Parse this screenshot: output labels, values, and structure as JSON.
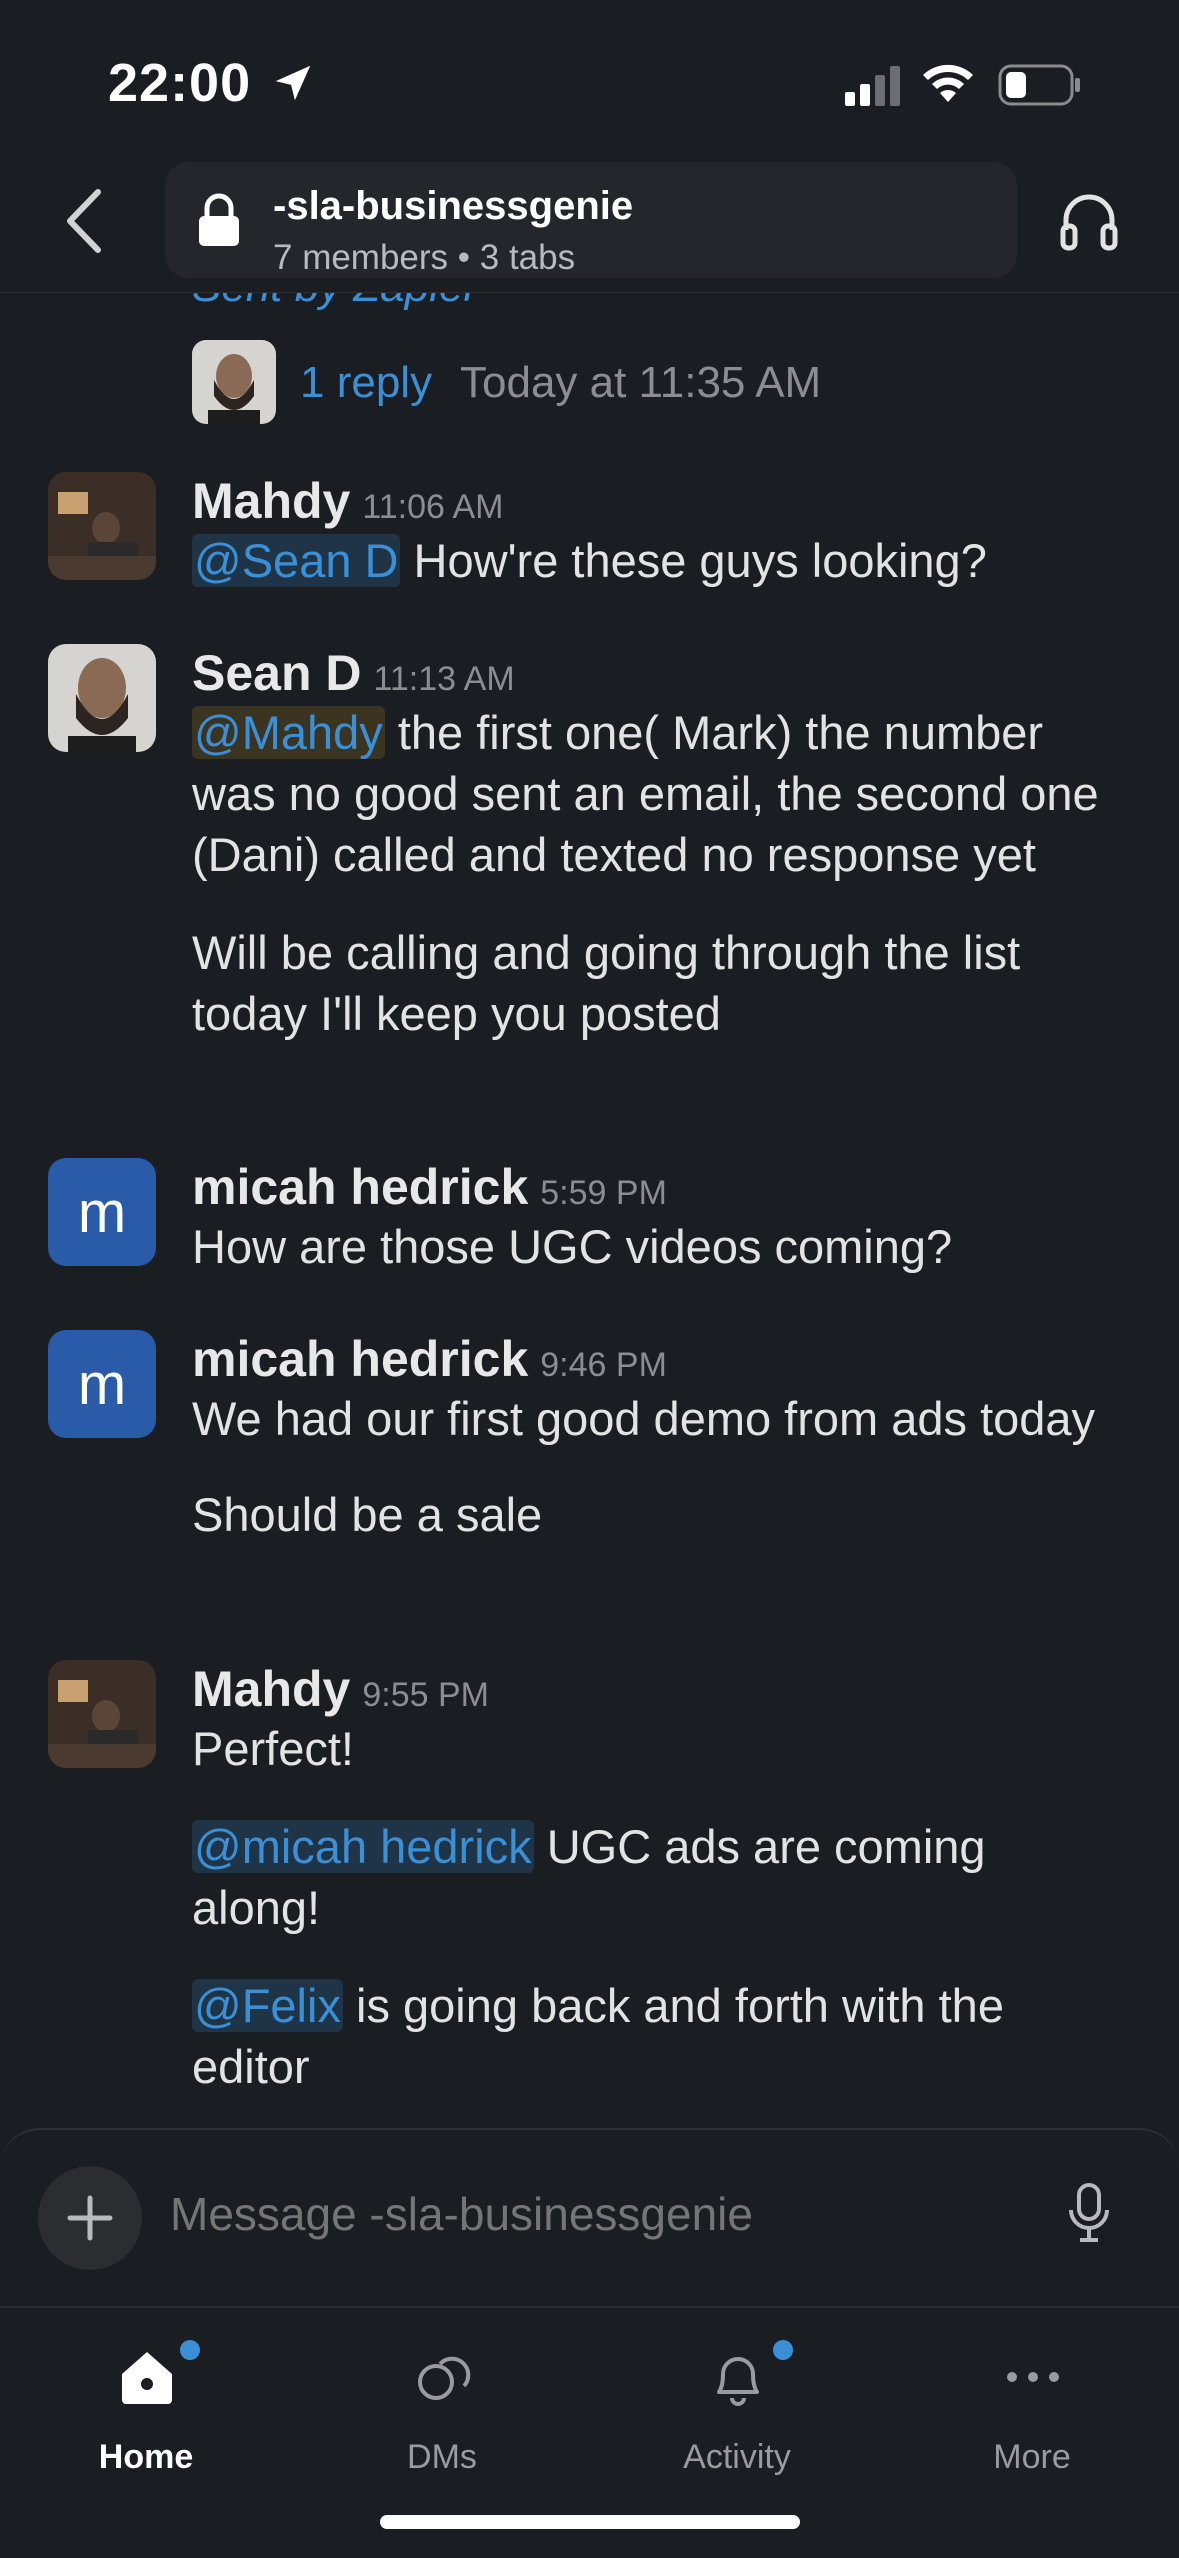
{
  "status_bar": {
    "time": "22:00"
  },
  "header": {
    "channel_name": "-sla-businessgenie",
    "channel_meta": "7 members • 3 tabs"
  },
  "thread": {
    "cutoff_text": "Sent by Zapier",
    "reply_count": "1 reply",
    "reply_time": "Today at 11:35 AM"
  },
  "messages": [
    {
      "name": "Mahdy",
      "time": "11:06 AM",
      "mention": "@Sean D",
      "text": " How're these guys looking?"
    },
    {
      "name": "Sean D",
      "time": "11:13 AM",
      "mention": "@Mahdy",
      "text": " the first one( Mark) the number was no good sent an email, the second one (Dani) called and texted no response yet",
      "text2": "Will be calling and going through the list today I'll keep you posted"
    },
    {
      "name": "micah hedrick",
      "time": "5:59 PM",
      "avatar_letter": "m",
      "text": "How are those UGC videos coming?"
    },
    {
      "name": "micah hedrick",
      "time": "9:46 PM",
      "avatar_letter": "m",
      "text": "We had our first good demo from ads today",
      "text2": "Should be a sale"
    },
    {
      "name": "Mahdy",
      "time": "9:55 PM",
      "text": "Perfect!",
      "mention2": "@micah hedrick",
      "text2": " UGC ads are coming along!",
      "mention3": "@Felix",
      "text3": " is going back and forth with the editor"
    }
  ],
  "composer": {
    "placeholder": "Message -sla-businessgenie"
  },
  "tabs": [
    {
      "label": "Home",
      "icon": "home-icon",
      "active": true,
      "badge": true
    },
    {
      "label": "DMs",
      "icon": "dms-icon",
      "active": false,
      "badge": false
    },
    {
      "label": "Activity",
      "icon": "bell-icon",
      "active": false,
      "badge": true
    },
    {
      "label": "More",
      "icon": "more-icon",
      "active": false,
      "badge": false
    }
  ],
  "colors": {
    "background": "#1a1d21",
    "link": "#3b8fd6",
    "avatar_blue": "#2a5ba8"
  }
}
